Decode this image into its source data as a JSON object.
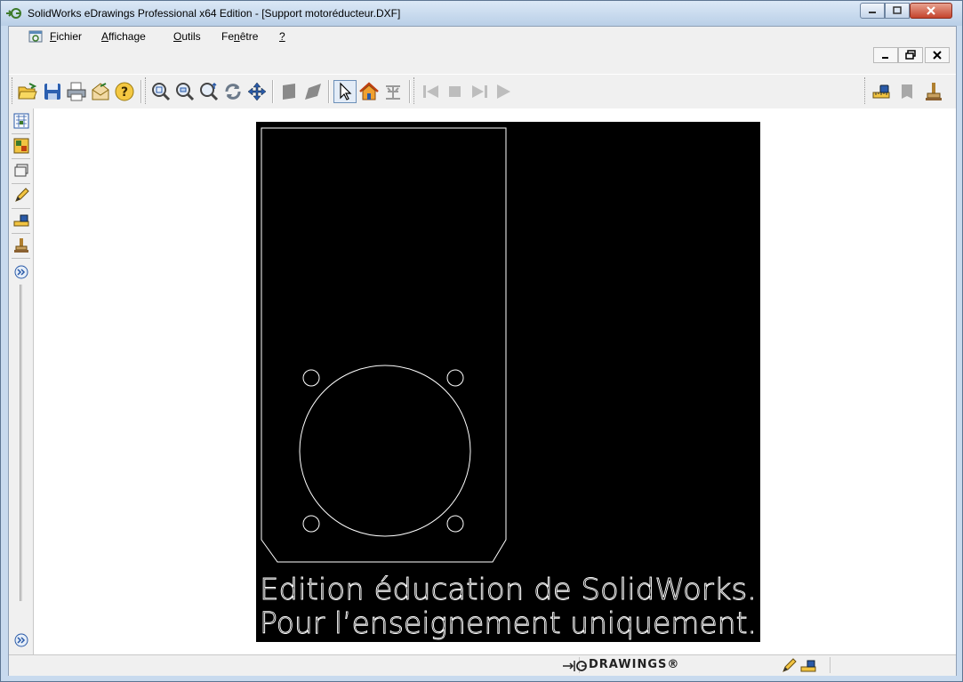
{
  "window": {
    "title": "SolidWorks eDrawings Professional x64 Edition - [Support motoréducteur.DXF]"
  },
  "menubar": {
    "items": [
      {
        "label": "Fichier",
        "mnemonic": "F"
      },
      {
        "label": "Affichage",
        "mnemonic": "A"
      },
      {
        "label": "Outils",
        "mnemonic": "O"
      },
      {
        "label": "Fenêtre",
        "mnemonic": "n"
      },
      {
        "label": "?",
        "mnemonic": "?"
      }
    ],
    "mdi_controls": {
      "minimize": "_",
      "restore": "🗗",
      "close": "x"
    }
  },
  "toolbar": {
    "groups": [
      [
        "open-icon",
        "save-icon",
        "print-icon",
        "send-mail-icon",
        "help-icon"
      ],
      [
        "zoom-fit-icon",
        "zoom-area-icon",
        "zoom-in-out-icon",
        "rotate-icon",
        "pan-icon"
      ],
      [
        "shaded-icon",
        "perspective-icon"
      ],
      [
        "select-icon",
        "home-icon",
        "markup-icon"
      ],
      [
        "first-frame-icon",
        "stop-icon",
        "next-frame-icon",
        "play-icon"
      ]
    ],
    "right": [
      "measure-icon",
      "stamp-gray-icon",
      "stamp-icon"
    ]
  },
  "sidebar": {
    "icons": [
      "sheets-icon",
      "components-icon",
      "layers-icon",
      "markup-pen-icon",
      "measure-icon",
      "stamp-icon",
      "expand-icon"
    ],
    "bottom_icon": "expand-icon"
  },
  "drawing": {
    "watermark_line1": "Edition éducation de SolidWorks.",
    "watermark_line2": "Pour l’enseignement uniquement."
  },
  "status": {
    "brand": "DRAWINGS®"
  },
  "colors": {
    "title_bg": "#c8daee",
    "canvas_bg": "#ffffff",
    "drawing_bg": "#000000",
    "drawing_lines": "#ffffff"
  }
}
